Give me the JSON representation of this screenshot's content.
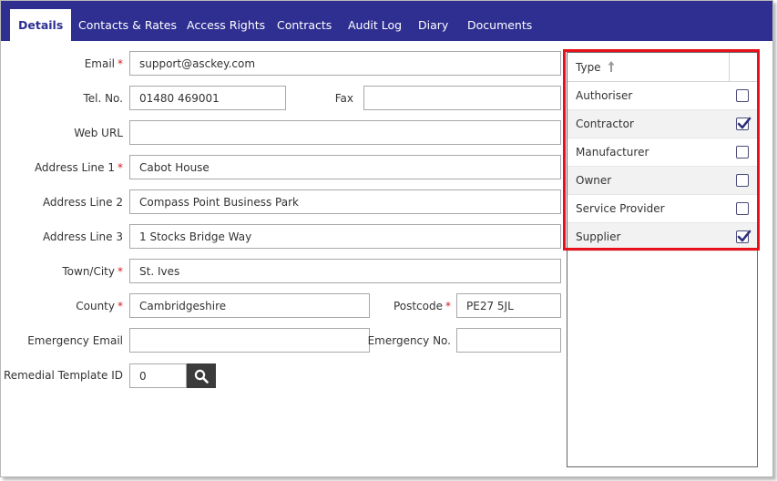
{
  "tabs": [
    {
      "label": "Details",
      "active": true
    },
    {
      "label": "Contacts & Rates"
    },
    {
      "label": "Access Rights"
    },
    {
      "label": "Contracts"
    },
    {
      "label": "Audit Log"
    },
    {
      "label": "Diary"
    },
    {
      "label": "Documents"
    }
  ],
  "form": {
    "email": {
      "label": "Email",
      "required": "*",
      "value": "support@asckey.com"
    },
    "tel": {
      "label": "Tel. No.",
      "value": "01480 469001"
    },
    "fax": {
      "label": "Fax",
      "value": ""
    },
    "web": {
      "label": "Web URL",
      "value": ""
    },
    "addr1": {
      "label": "Address Line 1",
      "required": "*",
      "value": "Cabot House"
    },
    "addr2": {
      "label": "Address Line 2",
      "value": "Compass Point Business Park"
    },
    "addr3": {
      "label": "Address Line 3",
      "value": "1 Stocks Bridge Way"
    },
    "town": {
      "label": "Town/City",
      "required": "*",
      "value": "St. Ives"
    },
    "county": {
      "label": "County",
      "required": "*",
      "value": "Cambridgeshire"
    },
    "postcode": {
      "label": "Postcode",
      "required": "*",
      "value": "PE27 5JL"
    },
    "emergency_email": {
      "label": "Emergency Email",
      "value": ""
    },
    "emergency_no": {
      "label": "Emergency No.",
      "value": ""
    },
    "remedial": {
      "label": "Remedial Template ID",
      "value": "0"
    }
  },
  "type_list": {
    "header": "Type",
    "sort": "ascending",
    "items": [
      {
        "label": "Authoriser",
        "checked": false
      },
      {
        "label": "Contractor",
        "checked": true
      },
      {
        "label": "Manufacturer",
        "checked": false
      },
      {
        "label": "Owner",
        "checked": false
      },
      {
        "label": "Service Provider",
        "checked": false
      },
      {
        "label": "Supplier",
        "checked": true
      }
    ]
  },
  "colors": {
    "tab_bar": "#2e2f91",
    "required": "#d11a1a",
    "highlight": "#e8101a"
  },
  "icons": {
    "search": "search-icon",
    "sort": "sort-ascending-icon",
    "check": "check-icon"
  }
}
